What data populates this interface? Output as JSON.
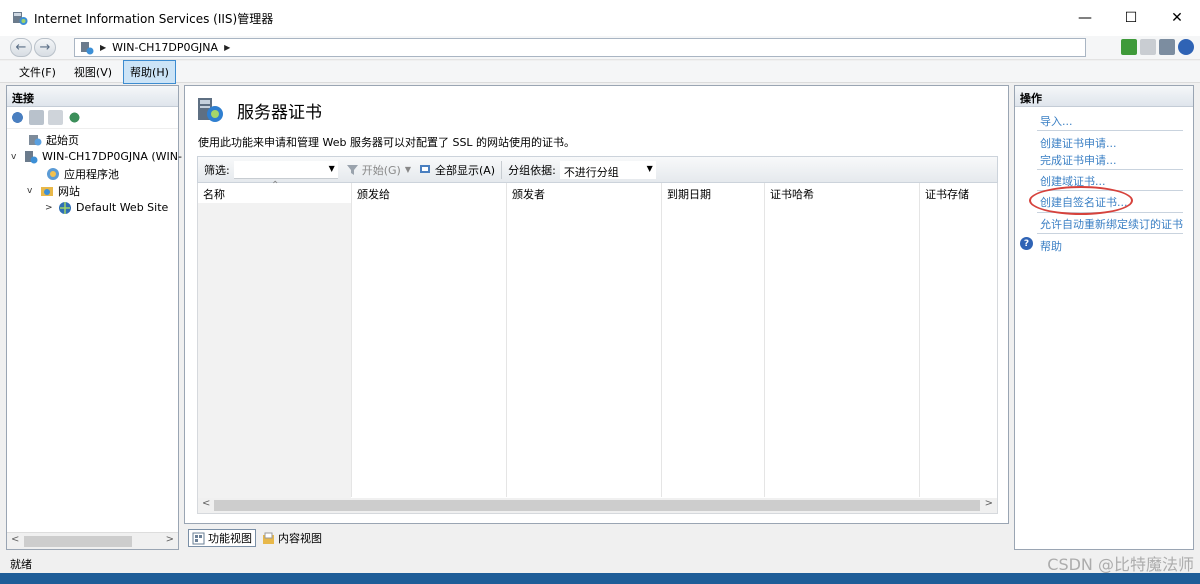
{
  "window": {
    "title": "Internet Information Services (IIS)管理器",
    "controls": {
      "minimize": "—",
      "maximize": "☐",
      "close": "✕"
    }
  },
  "address_bar": {
    "crumbs": [
      "WIN-CH17DP0GJNA"
    ],
    "toolbar_icons": [
      "refresh-icon",
      "stop-icon",
      "home-icon",
      "help-icon"
    ]
  },
  "menu": {
    "items": [
      "文件(F)",
      "视图(V)",
      "帮助(H)"
    ],
    "active_index": 2
  },
  "connections": {
    "header": "连接",
    "toolbar_icons": [
      "connect-icon",
      "save-icon",
      "disconnect-icon",
      "sites-icon"
    ],
    "tree": [
      {
        "label": "起始页",
        "icon": "start-page-icon",
        "level": 0,
        "expander": ""
      },
      {
        "label": "WIN-CH17DP0GJNA (WIN-",
        "icon": "server-icon",
        "level": 0,
        "expander": "v"
      },
      {
        "label": "应用程序池",
        "icon": "app-pool-icon",
        "level": 1,
        "expander": ""
      },
      {
        "label": "网站",
        "icon": "sites-folder-icon",
        "level": 1,
        "expander": "v"
      },
      {
        "label": "Default Web Site",
        "icon": "website-globe-icon",
        "level": 2,
        "expander": ">"
      }
    ]
  },
  "feature": {
    "title": "服务器证书",
    "description": "使用此功能来申请和管理 Web 服务器可以对配置了 SSL 的网站使用的证书。",
    "filter": {
      "label": "筛选:",
      "value": "",
      "go_button": "开始(G)",
      "show_all_button": "全部显示(A)",
      "group_by_label": "分组依据:",
      "group_by_value": "不进行分组"
    },
    "columns": [
      "名称",
      "颁发给",
      "颁发者",
      "到期日期",
      "证书哈希",
      "证书存储"
    ],
    "rows": []
  },
  "view_tabs": [
    "功能视图",
    "内容视图"
  ],
  "actions": {
    "header": "操作",
    "items": [
      "导入...",
      "创建证书申请...",
      "完成证书申请...",
      "创建域证书...",
      "创建自签名证书...",
      "允许自动重新绑定续订的证书",
      "帮助"
    ]
  },
  "status": {
    "text": "就绪"
  },
  "watermark": "CSDN @比特魔法师",
  "colors": {
    "link": "#3a7fc4",
    "annotation": "#d6423c",
    "panel_border": "#9aa5b3"
  }
}
